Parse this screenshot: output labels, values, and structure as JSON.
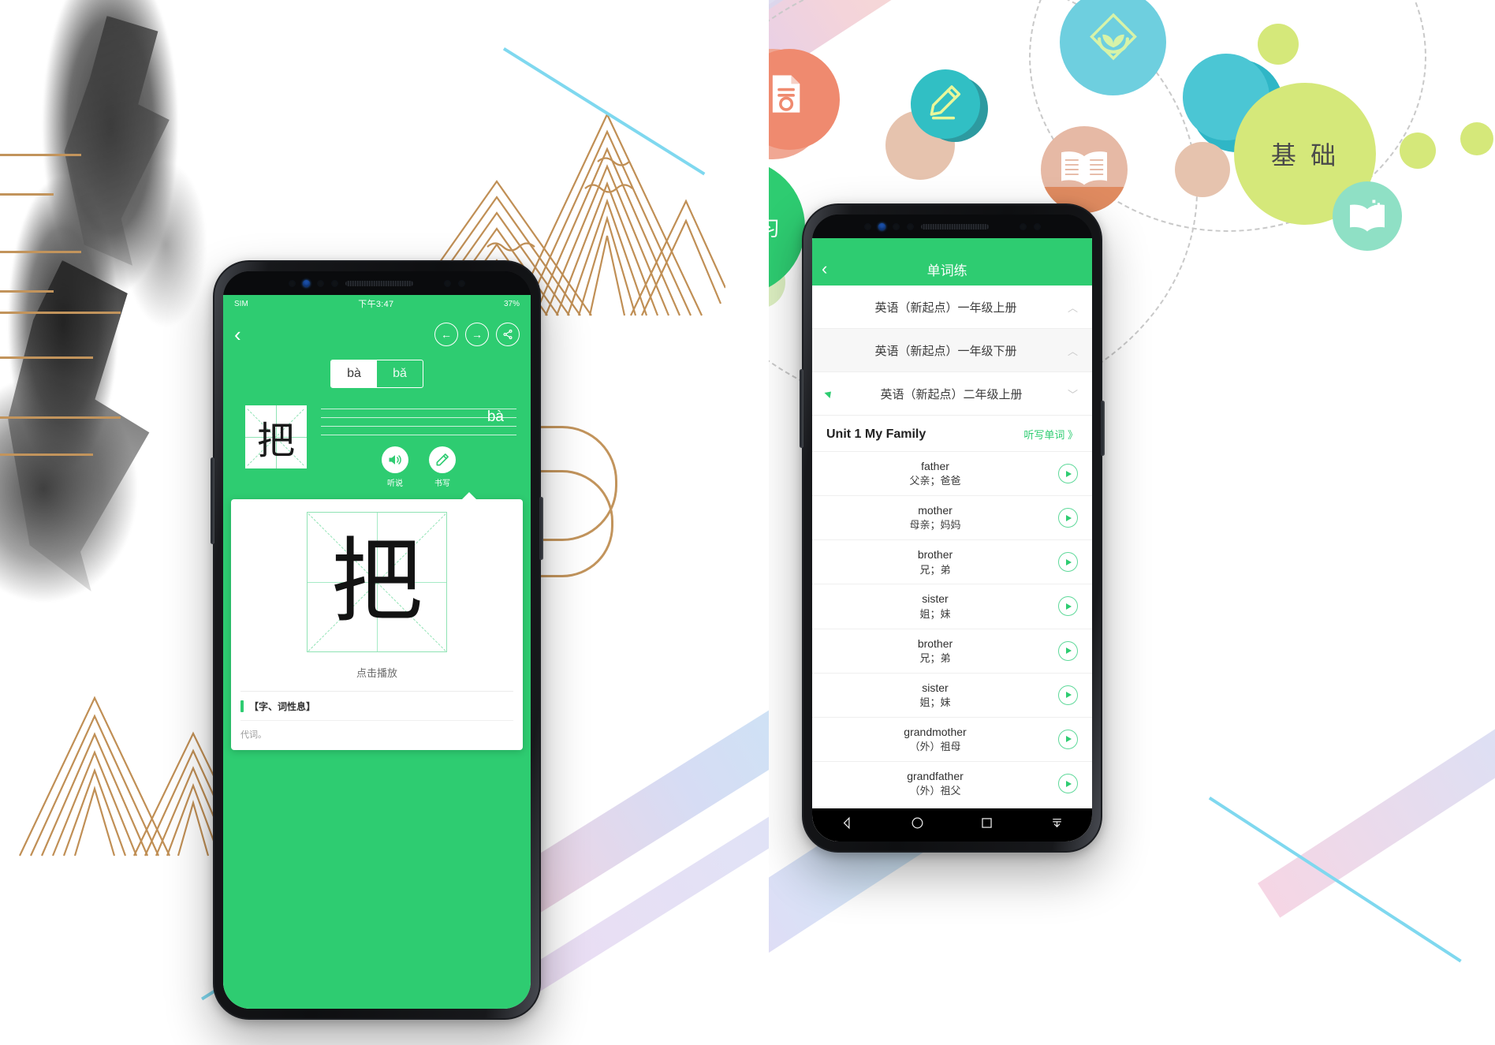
{
  "left_panel": {
    "phone": {
      "status_bar": {
        "carrier": "SIM",
        "time": "下午3:47",
        "battery": "37%"
      },
      "nav": {
        "back_icon": "chevron-left-icon",
        "prev_icon": "arrow-left-circle-icon",
        "next_icon": "arrow-right-circle-icon",
        "share_icon": "share-icon"
      },
      "tabs": [
        {
          "label": "bà",
          "active": true
        },
        {
          "label": "bǎ",
          "active": false
        }
      ],
      "character": "把",
      "pinyin": "bà",
      "actions": [
        {
          "label": "听说",
          "icon": "speaker-icon"
        },
        {
          "label": "书写",
          "icon": "pencil-icon"
        }
      ],
      "popup": {
        "character": "把",
        "play_hint": "点击播放",
        "section_title": "【字、词性息】",
        "section_body": "代词。"
      }
    }
  },
  "right_panel": {
    "bubbles": [
      {
        "label": "单词练习",
        "color": "#2ecc71"
      },
      {
        "label": "基 础",
        "color": "#d5e87a"
      }
    ],
    "decor_icons": [
      {
        "name": "document-icon",
        "color": "#ef8a6f"
      },
      {
        "name": "pencil-icon",
        "color": "#31bfc4"
      },
      {
        "name": "book-icon",
        "color": "#e6b9a5"
      },
      {
        "name": "plant-hands-icon",
        "color": "#6ecfdf"
      },
      {
        "name": "open-book-icon",
        "color": "#8fe0c5"
      }
    ],
    "phone": {
      "nav": {
        "back_icon": "chevron-left-icon",
        "title": "单词练"
      },
      "accordions": [
        {
          "label": "英语（新起点）一年级上册",
          "chevron": "︿",
          "expanded": false,
          "selected": false
        },
        {
          "label": "英语（新起点）一年级下册",
          "chevron": "︿",
          "expanded": false,
          "selected": false
        },
        {
          "label": "英语（新起点）二年级上册",
          "chevron": "﹀",
          "expanded": true,
          "selected": true
        }
      ],
      "unit": {
        "name": "Unit 1 My Family",
        "action": "听写单词 》"
      },
      "words": [
        {
          "en": "father",
          "cn": "父亲；爸爸",
          "play": "play-icon"
        },
        {
          "en": "mother",
          "cn": "母亲；妈妈",
          "play": "play-icon"
        },
        {
          "en": "brother",
          "cn": "兄；弟",
          "play": "play-icon"
        },
        {
          "en": "sister",
          "cn": "姐；妹",
          "play": "play-icon"
        },
        {
          "en": "brother",
          "cn": "兄；弟",
          "play": "play-icon"
        },
        {
          "en": "sister",
          "cn": "姐；妹",
          "play": "play-icon"
        },
        {
          "en": "grandmother",
          "cn": "（外）祖母",
          "play": "play-icon"
        },
        {
          "en": "grandfather",
          "cn": "（外）祖父",
          "play": "play-icon"
        }
      ],
      "navbar": [
        {
          "name": "back-nav-icon"
        },
        {
          "name": "home-nav-icon"
        },
        {
          "name": "recents-nav-icon"
        },
        {
          "name": "hide-nav-icon"
        }
      ]
    }
  },
  "colors": {
    "brand_green": "#2ecc71",
    "gold": "#c08f55",
    "lime": "#d5e87a",
    "coral": "#ef8a6f",
    "teal": "#31bfc4"
  }
}
